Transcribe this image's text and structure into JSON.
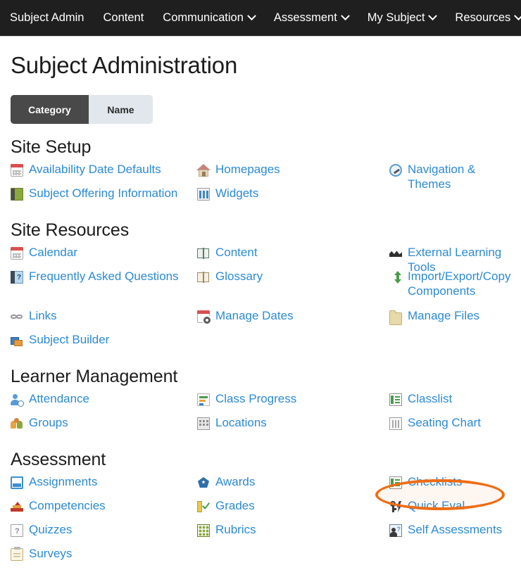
{
  "navbar": {
    "items": [
      {
        "label": "Subject Admin",
        "has_caret": false,
        "icon": ""
      },
      {
        "label": "Content",
        "has_caret": false,
        "icon": ""
      },
      {
        "label": "Communication",
        "has_caret": true,
        "icon": "chevron-down-icon"
      },
      {
        "label": "Assessment",
        "has_caret": true,
        "icon": "chevron-down-icon"
      },
      {
        "label": "My Subject",
        "has_caret": true,
        "icon": "chevron-down-icon"
      },
      {
        "label": "Resources",
        "has_caret": true,
        "icon": "chevron-down-icon"
      }
    ]
  },
  "page": {
    "title": "Subject Administration"
  },
  "tabs": {
    "items": [
      {
        "label": "Category",
        "active": true
      },
      {
        "label": "Name",
        "active": false
      }
    ]
  },
  "sections": [
    {
      "title": "Site Setup",
      "rows": [
        [
          {
            "label": "Availability Date Defaults",
            "icon": "calendar-icon"
          },
          {
            "label": "Homepages",
            "icon": "house-icon"
          },
          {
            "label": "Navigation & Themes",
            "icon": "compass-icon"
          }
        ],
        [
          {
            "label": "Subject Offering Information",
            "icon": "book-icon"
          },
          {
            "label": "Widgets",
            "icon": "widgets-icon"
          },
          {
            "label": "",
            "icon": ""
          }
        ]
      ]
    },
    {
      "title": "Site Resources",
      "rows": [
        [
          {
            "label": "Calendar",
            "icon": "calendar-icon"
          },
          {
            "label": "Content",
            "icon": "open-book-icon"
          },
          {
            "label": "External Learning Tools",
            "icon": "external-tool-icon"
          }
        ],
        [
          {
            "label": "Frequently Asked Questions",
            "icon": "faq-icon"
          },
          {
            "label": "Glossary",
            "icon": "open-book-tan-icon"
          },
          {
            "label": "Import/Export/Copy Components",
            "icon": "import-export-icon"
          }
        ],
        [
          {
            "label": "Links",
            "icon": "chain-link-icon"
          },
          {
            "label": "Manage Dates",
            "icon": "manage-dates-icon"
          },
          {
            "label": "Manage Files",
            "icon": "folder-icon"
          }
        ],
        [
          {
            "label": "Subject Builder",
            "icon": "subject-builder-icon"
          },
          {
            "label": "",
            "icon": ""
          },
          {
            "label": "",
            "icon": ""
          }
        ]
      ]
    },
    {
      "title": "Learner Management",
      "rows": [
        [
          {
            "label": "Attendance",
            "icon": "attendance-icon"
          },
          {
            "label": "Class Progress",
            "icon": "class-progress-icon"
          },
          {
            "label": "Classlist",
            "icon": "classlist-icon"
          }
        ],
        [
          {
            "label": "Groups",
            "icon": "groups-icon"
          },
          {
            "label": "Locations",
            "icon": "building-icon"
          },
          {
            "label": "Seating Chart",
            "icon": "seating-chart-icon"
          }
        ]
      ]
    },
    {
      "title": "Assessment",
      "rows": [
        [
          {
            "label": "Assignments",
            "icon": "assignments-icon"
          },
          {
            "label": "Awards",
            "icon": "award-badge-icon"
          },
          {
            "label": "Checklists",
            "icon": "checklist-icon"
          }
        ],
        [
          {
            "label": "Competencies",
            "icon": "pyramid-icon"
          },
          {
            "label": "Grades",
            "icon": "grades-icon"
          },
          {
            "label": "Quick Eval",
            "icon": "quick-eval-icon"
          }
        ],
        [
          {
            "label": "Quizzes",
            "icon": "quiz-icon"
          },
          {
            "label": "Rubrics",
            "icon": "rubrics-icon"
          },
          {
            "label": "Self Assessments",
            "icon": "self-assessment-icon"
          }
        ],
        [
          {
            "label": "Surveys",
            "icon": "clipboard-icon"
          },
          {
            "label": "",
            "icon": ""
          },
          {
            "label": "",
            "icon": ""
          }
        ]
      ]
    }
  ],
  "annotation": {
    "target_label": "Quick Eval",
    "shape": "ellipse",
    "color": "#ef6c14"
  },
  "colors": {
    "navbar_bg": "#1f1f1f",
    "link_blue": "#2b8ad8",
    "tab_active_bg": "#494949",
    "tab_inactive_bg": "#e1e7ec",
    "highlight": "#ef6c14",
    "heading": "#1c1c1c"
  }
}
